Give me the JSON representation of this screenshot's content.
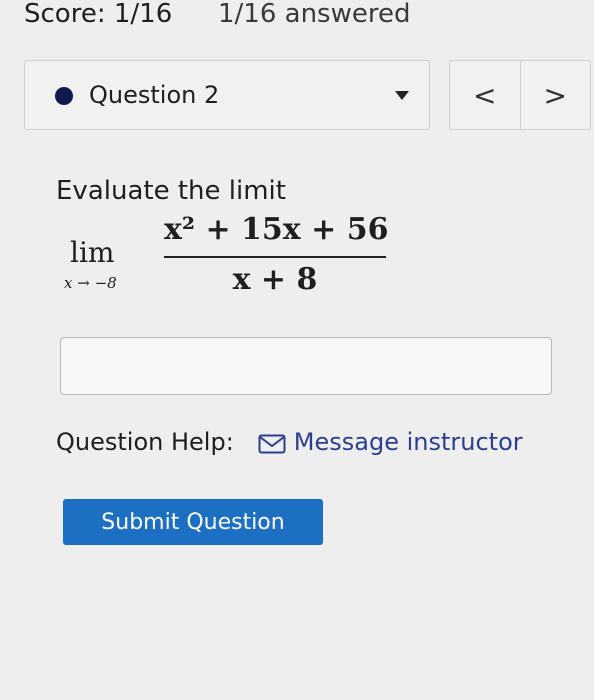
{
  "header": {
    "score": "Score: 1/16",
    "answered": "1/16 answered"
  },
  "question_nav": {
    "label": "Question 2",
    "prev_icon": "chevron-left-icon",
    "prev_symbol": "<",
    "next_icon": "chevron-right-icon",
    "next_symbol": ">"
  },
  "question": {
    "prompt": "Evaluate the limit",
    "lim": "lim",
    "lim_sub": "x → −8",
    "numerator": "x² + 15x + 56",
    "denominator": "x + 8"
  },
  "answer": {
    "value": "",
    "placeholder": ""
  },
  "help": {
    "label": "Question Help:",
    "icon": "mail-icon",
    "link": "Message instructor"
  },
  "submit": {
    "label": "Submit Question"
  },
  "colors": {
    "accent_button": "#1c6fc2",
    "link": "#2b3f8f",
    "status_dot": "#101a4a"
  }
}
